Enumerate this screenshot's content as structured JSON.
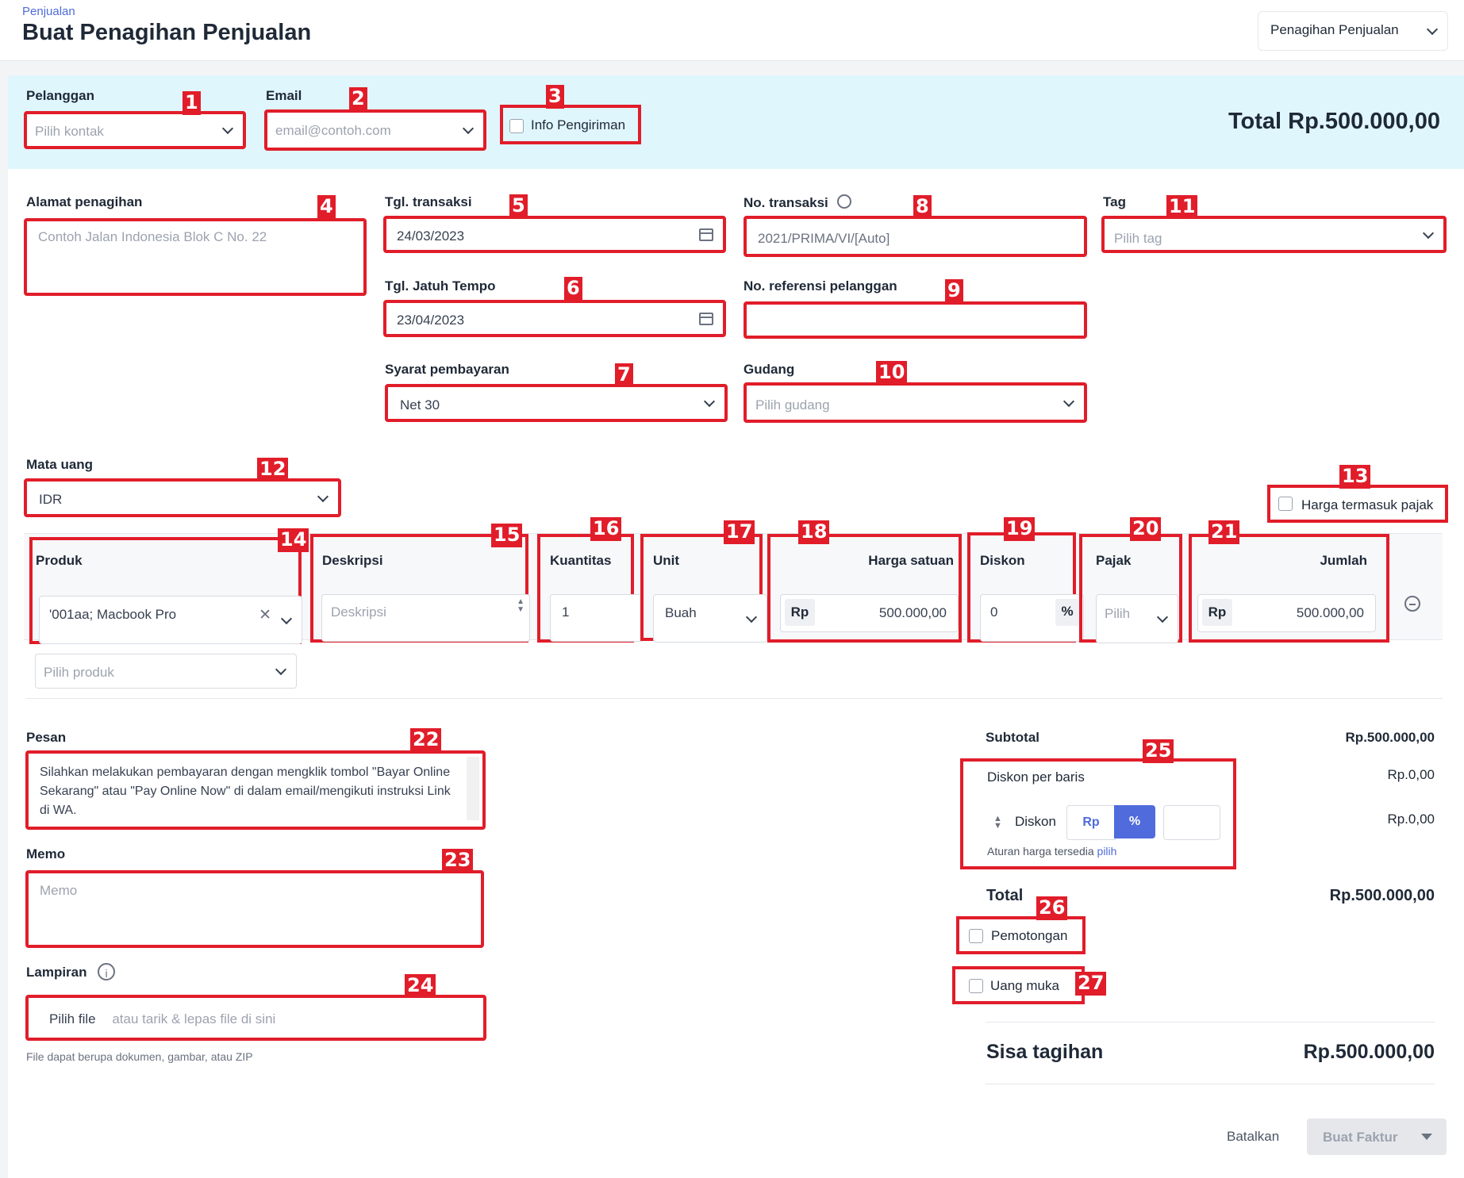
{
  "breadcrumb": "Penjualan",
  "page_title": "Buat Penagihan Penjualan",
  "doc_type_select": "Penagihan Penjualan",
  "customer": {
    "label": "Pelanggan",
    "placeholder": "Pilih kontak"
  },
  "email": {
    "label": "Email",
    "placeholder": "email@contoh.com"
  },
  "shipping_info": {
    "label": "Info Pengiriman"
  },
  "header_total": "Total Rp.500.000,00",
  "billing_address": {
    "label": "Alamat penagihan",
    "placeholder": "Contoh Jalan Indonesia Blok C No. 22"
  },
  "transaction_date": {
    "label": "Tgl. transaksi",
    "value": "24/03/2023"
  },
  "due_date": {
    "label": "Tgl. Jatuh Tempo",
    "value": "23/04/2023"
  },
  "payment_terms": {
    "label": "Syarat pembayaran",
    "value": "Net 30"
  },
  "transaction_no": {
    "label": "No. transaksi",
    "placeholder": "2021/PRIMA/VI/[Auto]"
  },
  "customer_ref": {
    "label": "No. referensi pelanggan",
    "value": ""
  },
  "warehouse": {
    "label": "Gudang",
    "placeholder": "Pilih gudang"
  },
  "tag": {
    "label": "Tag",
    "placeholder": "Pilih tag"
  },
  "currency": {
    "label": "Mata uang",
    "value": "IDR"
  },
  "tax_inclusive": {
    "label": "Harga termasuk pajak"
  },
  "columns": {
    "produk": "Produk",
    "deskripsi": "Deskripsi",
    "kuantitas": "Kuantitas",
    "unit": "Unit",
    "harga": "Harga satuan",
    "diskon": "Diskon",
    "pajak": "Pajak",
    "jumlah": "Jumlah"
  },
  "line_item": {
    "product": "'001aa; Macbook Pro",
    "description_placeholder": "Deskripsi",
    "quantity": "1",
    "unit": "Buah",
    "currency_prefix": "Rp",
    "price": "500.000,00",
    "discount": "0",
    "discount_suffix": "%",
    "tax_placeholder": "Pilih",
    "amount": "500.000,00"
  },
  "add_product_placeholder": "Pilih produk",
  "message": {
    "label": "Pesan",
    "value": "Silahkan melakukan pembayaran dengan mengklik tombol \"Bayar Online Sekarang\" atau \"Pay Online Now\" di dalam email/mengikuti instruksi Link di WA."
  },
  "memo": {
    "label": "Memo",
    "placeholder": "Memo"
  },
  "attachment": {
    "label": "Lampiran",
    "button": "Pilih file",
    "hint": "atau tarik & lepas file di sini",
    "note": "File dapat berupa dokumen, gambar, atau ZIP"
  },
  "summary": {
    "subtotal_label": "Subtotal",
    "subtotal_value": "Rp.500.000,00",
    "line_discount_label": "Diskon per baris",
    "line_discount_value": "Rp.0,00",
    "discount_label": "Diskon",
    "discount_rp": "Rp",
    "discount_pct": "%",
    "discount_value": "Rp.0,00",
    "price_rules": "Aturan harga tersedia",
    "price_rules_link": "pilih",
    "total_label": "Total",
    "total_value": "Rp.500.000,00",
    "withholding": "Pemotongan",
    "down_payment": "Uang muka",
    "balance_label": "Sisa tagihan",
    "balance_value": "Rp.500.000,00"
  },
  "actions": {
    "cancel": "Batalkan",
    "create": "Buat Faktur"
  },
  "badges": [
    "1",
    "2",
    "3",
    "4",
    "5",
    "6",
    "7",
    "8",
    "9",
    "10",
    "11",
    "12",
    "13",
    "14",
    "15",
    "16",
    "17",
    "18",
    "19",
    "20",
    "21",
    "22",
    "23",
    "24",
    "25",
    "26",
    "27"
  ],
  "colors": {
    "highlight": "#e11d2a",
    "accent": "#4f6bdc",
    "header_band": "#e0f6fd"
  }
}
